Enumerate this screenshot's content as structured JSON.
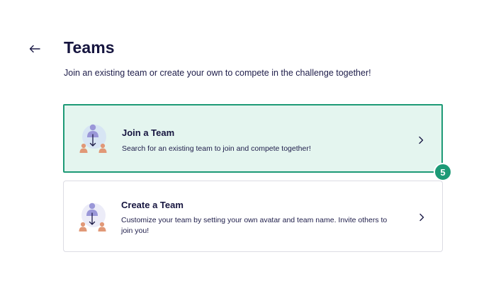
{
  "header": {
    "back_icon": "arrow-left-icon",
    "title": "Teams",
    "subtitle": "Join an existing team or create your own to compete in the challenge together!"
  },
  "options": [
    {
      "title": "Join a Team",
      "description": "Search for an existing team to join and compete together!",
      "icon": "team-join-icon",
      "selected": true
    },
    {
      "title": "Create a Team",
      "description": "Customize your team by setting your own avatar and team name. Invite others to join you!",
      "icon": "team-create-icon",
      "selected": false
    }
  ],
  "step_badge": "5",
  "colors": {
    "accent": "#1d9a76",
    "selected_bg": "#e4f5ef",
    "text": "#16153f",
    "person_main": "#9a97d8",
    "person_secondary": "#e19877",
    "arrow": "#1b1a46"
  }
}
